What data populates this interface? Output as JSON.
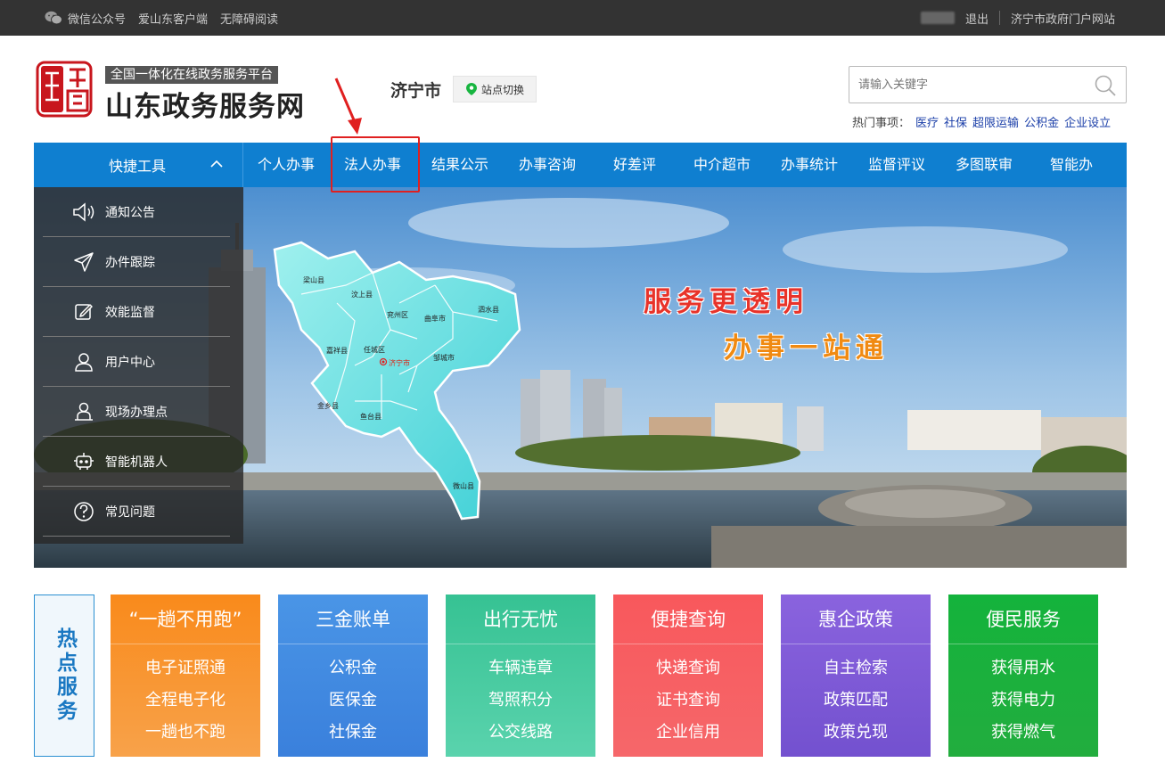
{
  "topbar": {
    "wechat": "微信公众号",
    "app": "爱山东客户端",
    "accessible": "无障碍阅读",
    "logout": "退出",
    "portal": "济宁市政府门户网站"
  },
  "header": {
    "slogan": "全国一体化在线政务服务平台",
    "site_name": "山东政务服务网",
    "city": "济宁市",
    "switch_label": "站点切换",
    "search_placeholder": "请输入关键字",
    "hot_label": "热门事项：",
    "hot_items": [
      "医疗",
      "社保",
      "超限运输",
      "公积金",
      "企业设立"
    ]
  },
  "nav": {
    "tools_label": "快捷工具",
    "items": [
      "个人办事",
      "法人办事",
      "结果公示",
      "办事咨询",
      "好差评",
      "中介超市",
      "办事统计",
      "监督评议",
      "多图联审",
      "智能办"
    ]
  },
  "side_menu": [
    "通知公告",
    "办件跟踪",
    "效能监督",
    "用户中心",
    "现场办理点",
    "智能机器人",
    "常见问题"
  ],
  "banner": {
    "line1": "服务更透明",
    "line2": "办事一站通",
    "map_labels": [
      "梁山县",
      "汶上县",
      "兖州区",
      "曲阜市",
      "泗水县",
      "嘉祥县",
      "任城区",
      "济宁市",
      "邹城市",
      "金乡县",
      "鱼台县",
      "微山县"
    ]
  },
  "hot_services": {
    "label": "热点服务",
    "cards": [
      {
        "title": "“一趟不用跑”",
        "items": [
          "电子证照通",
          "全程电子化",
          "一趟也不跑"
        ],
        "color": "#f7891c"
      },
      {
        "title": "三金账单",
        "items": [
          "公积金",
          "医保金",
          "社保金"
        ],
        "color": "#3d8be0"
      },
      {
        "title": "出行无忧",
        "items": [
          "车辆违章",
          "驾照积分",
          "公交线路"
        ],
        "color": "#3dc49a"
      },
      {
        "title": "便捷查询",
        "items": [
          "快递查询",
          "证书查询",
          "企业信用"
        ],
        "color": "#f5585c"
      },
      {
        "title": "惠企政策",
        "items": [
          "自主检索",
          "政策匹配",
          "政策兑现"
        ],
        "color": "#7b58d6"
      },
      {
        "title": "便民服务",
        "items": [
          "获得用水",
          "获得电力",
          "获得燃气"
        ],
        "color": "#18b540"
      }
    ]
  }
}
